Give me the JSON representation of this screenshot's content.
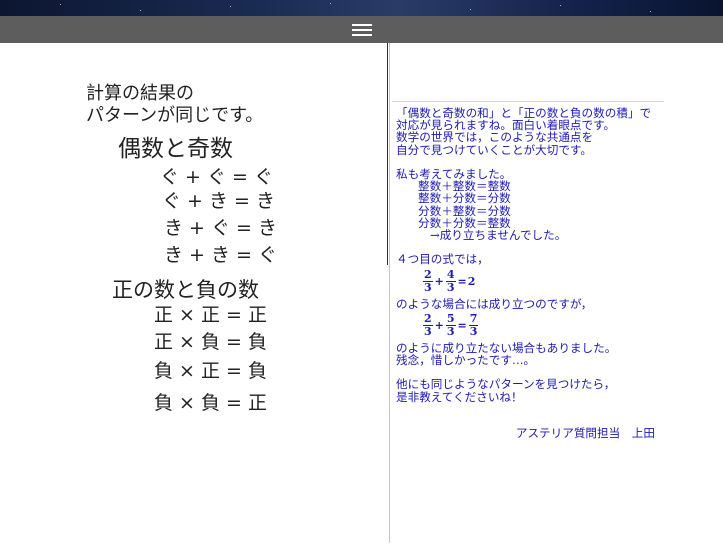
{
  "handwriting": {
    "lines": [
      "計算の結果の",
      "パターンが同じです。",
      "偶数と奇数",
      "ぐ + ぐ = ぐ",
      "ぐ + き = き",
      "き + ぐ = き",
      "き + き = ぐ",
      "正の数と負の数",
      "正 × 正 = 正",
      "正 × 負 = 負",
      "負 × 正 = 負",
      "負 × 負 = 正"
    ]
  },
  "comment": {
    "p1": [
      "「偶数と奇数の和」と「正の数と負の数の積」で",
      "対応が見られますね。面白い着眼点です。",
      "数学の世界では，このような共通点を",
      "自分で見つけていくことが大切です。"
    ],
    "p2_intro": "私も考えてみました。",
    "p2_items": [
      "整数＋整数＝整数",
      "整数＋分数＝分数",
      "分数＋整数＝分数",
      "分数＋分数＝整数"
    ],
    "p2_result": "→成り立ちませんでした。",
    "p3_intro": "４つ目の式では，",
    "eq1": {
      "a_num": "2",
      "a_den": "3",
      "op": "+",
      "b_num": "4",
      "b_den": "3",
      "eq": "=",
      "result": "2"
    },
    "p3_mid": "のような場合には成り立つのですが，",
    "eq2": {
      "a_num": "2",
      "a_den": "3",
      "op": "+",
      "b_num": "5",
      "b_den": "3",
      "eq": "=",
      "r_num": "7",
      "r_den": "3"
    },
    "p3_end": [
      "のように成り立たない場合もありました。",
      "残念，惜しかったです…。"
    ],
    "p4": [
      "他にも同じようなパターンを見つけたら，",
      "是非教えてくださいね！"
    ],
    "signature": "アステリア質問担当　上田"
  }
}
